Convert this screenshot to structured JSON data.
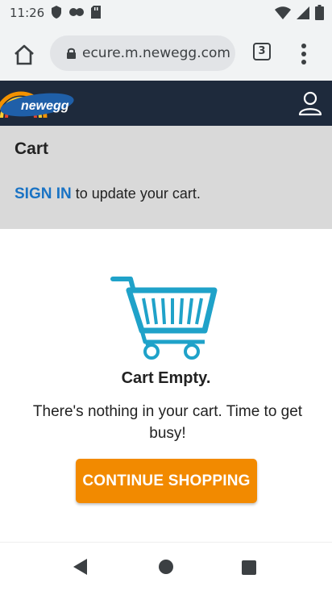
{
  "status_bar": {
    "time": "11:26"
  },
  "browser": {
    "url": "ecure.m.newegg.com",
    "tab_count": "3"
  },
  "site": {
    "logo_text": "newegg"
  },
  "cart": {
    "title": "Cart",
    "sign_in_link": "SIGN IN",
    "sign_in_suffix": "to update your cart.",
    "empty_title": "Cart Empty.",
    "empty_message": "There's nothing in your cart. Time to get busy!",
    "continue_button": "CONTINUE SHOPPING"
  },
  "colors": {
    "header_bg": "#1e2a3c",
    "link": "#1a73c4",
    "button_orange": "#f28a00",
    "cart_teal": "#1fa2c9"
  }
}
